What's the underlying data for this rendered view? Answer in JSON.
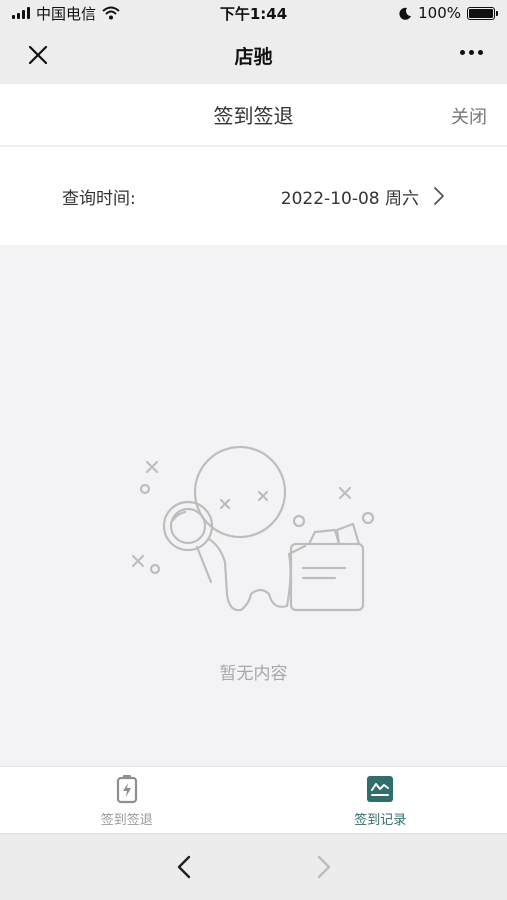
{
  "status_bar": {
    "carrier": "中国电信",
    "time": "下午1:44",
    "battery": "100%",
    "battery_level": 1.0
  },
  "navbar": {
    "title": "店驰"
  },
  "page": {
    "title": "签到签退",
    "close_label": "关闭"
  },
  "query": {
    "label": "查询时间:",
    "date": "2022-10-08 周六"
  },
  "empty_state": {
    "text": "暂无内容"
  },
  "tabbar": {
    "tabs": [
      {
        "label": "签到签退",
        "icon": "battery-charge-icon",
        "active": false
      },
      {
        "label": "签到记录",
        "icon": "chart-line-icon",
        "active": true
      }
    ]
  },
  "colors": {
    "accent": "#2f6e6a",
    "inactive": "#9a9a9a",
    "empty_text": "#a8a8a8"
  }
}
